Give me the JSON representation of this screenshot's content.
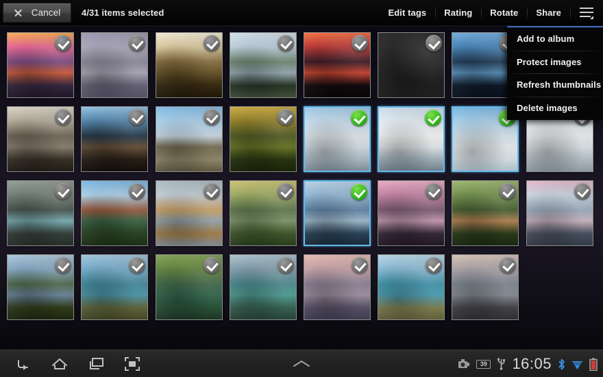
{
  "topbar": {
    "cancel_label": "Cancel",
    "selection_status": "4/31 items selected",
    "actions": [
      {
        "label": "Edit tags",
        "name": "edit-tags"
      },
      {
        "label": "Rating",
        "name": "rating"
      },
      {
        "label": "Rotate",
        "name": "rotate"
      },
      {
        "label": "Share",
        "name": "share"
      }
    ],
    "overflow_icon": "hamburger-menu-icon"
  },
  "menu": {
    "accent_color": "#3f6fbf",
    "items": [
      {
        "label": "Add to album"
      },
      {
        "label": "Protect images"
      },
      {
        "label": "Refresh thumbnails"
      },
      {
        "label": "Delete images"
      }
    ]
  },
  "selection": {
    "selected_count": 4,
    "total_count": 31,
    "selected_color": "#33b81e",
    "unselected_color": "#6f6f6f",
    "selected_border_color": "#63b8e8"
  },
  "grid": {
    "columns": 8,
    "rows": [
      {
        "thumbs": [
          {
            "selected": false,
            "desc": "sunset-lake-purple-mountains",
            "sky1": "#f9a84e",
            "sky2": "#e8608f",
            "sky3": "#7e4a86",
            "land": "#3a2a46",
            "water": "#d9603f",
            "fg": "#241a2b"
          },
          {
            "selected": false,
            "desc": "foggy-pine-forest",
            "sky1": "#9a96ad",
            "sky2": "#a8a4b8",
            "sky3": "#8f8ca0",
            "land": "#6d6a80",
            "water": "#b5b2c2",
            "fg": "#5e5b70"
          },
          {
            "selected": false,
            "desc": "horse-in-golden-field",
            "sky1": "#f0e7d2",
            "sky2": "#d9c79a",
            "sky3": "#8a6e3c",
            "land": "#3c2e14",
            "water": "#6b5526",
            "fg": "#241a08"
          },
          {
            "selected": false,
            "desc": "chapel-reflected-in-lake",
            "sky1": "#cfdde8",
            "sky2": "#b9cddb",
            "sky3": "#6f8a74",
            "land": "#2c3a2a",
            "water": "#9fb3bd",
            "fg": "#46563f"
          },
          {
            "selected": false,
            "desc": "bare-trees-red-sunset",
            "sky1": "#f26a3c",
            "sky2": "#b8302f",
            "sky3": "#3a1620",
            "land": "#120a10",
            "water": "#d1452f",
            "fg": "#0a0608"
          },
          {
            "selected": false,
            "desc": "dramatic-clouds-over-lake",
            "sky1": "#8fa8bc",
            "sky2": "#5b7287",
            "sky3": "#2c3c4c",
            "land": "#1a2430",
            "water": "#45soon",
            "fg": "#16202a"
          },
          {
            "selected": false,
            "desc": "lone-tree-blue-lake",
            "sky1": "#6aa8d8",
            "sky2": "#3f7fb5",
            "sky3": "#1c3a58",
            "land": "#0f1c2c",
            "water": "#5e9ccb",
            "fg": "#0a1420"
          },
          {
            "selected": false,
            "desc": "winter-tree-snow-field-hidden",
            "sky1": "#7fb3d8",
            "sky2": "#4c86b4",
            "sky3": "#26445e",
            "land": "#dfe8ef",
            "water": "#8fb8d4",
            "fg": "#1a2c3c"
          }
        ]
      },
      {
        "thumbs": [
          {
            "selected": false,
            "desc": "sunbeams-through-trees",
            "sky1": "#d8d2c4",
            "sky2": "#b0a896",
            "sky3": "#6f6454",
            "land": "#3c352a",
            "water": "#8e8472",
            "fg": "#241f18"
          },
          {
            "selected": false,
            "desc": "forest-backlit-trunks",
            "sky1": "#8fc0e0",
            "sky2": "#4b7fa8",
            "sky3": "#1f3444",
            "land": "#2b2118",
            "water": "#6a533a",
            "fg": "#140f0a"
          },
          {
            "selected": false,
            "desc": "pine-tree-blue-sky-field",
            "sky1": "#7fb8e4",
            "sky2": "#a7cfea",
            "sky3": "#cfe0ee",
            "land": "#9c9374",
            "water": "#7e7558",
            "fg": "#6a6248"
          },
          {
            "selected": false,
            "desc": "autumn-golden-forest",
            "sky1": "#c9a93c",
            "sky2": "#8e7a20",
            "sky3": "#4e5a1c",
            "land": "#2c3a12",
            "water": "#6d7c24",
            "fg": "#1c2608"
          },
          {
            "selected": true,
            "desc": "snowy-mountain-hut",
            "sky1": "#9cc6e4",
            "sky2": "#c6dced",
            "sky3": "#e8f0f6",
            "land": "#b9c9d4",
            "water": "#dfe9f0",
            "fg": "#8b9aa6"
          },
          {
            "selected": true,
            "desc": "snow-covered-fir-trees",
            "sky1": "#c8dbe8",
            "sky2": "#e4eef4",
            "sky3": "#ffffff",
            "land": "#aebfca",
            "water": "#f0f5f8",
            "fg": "#7e8e9a"
          },
          {
            "selected": true,
            "desc": "snowy-field-blue-sky",
            "sky1": "#74b4e0",
            "sky2": "#a8d0ea",
            "sky3": "#dfeef8",
            "land": "#e8f2f8",
            "water": "#f4f9fc",
            "fg": "#c0d4e0"
          },
          {
            "selected": false,
            "desc": "lone-snowy-fir-hidden",
            "sky1": "#cdd8e0",
            "sky2": "#e2e9ee",
            "sky3": "#f4f7f9",
            "land": "#c0ccd4",
            "water": "#e8eef2",
            "fg": "#9daab4"
          }
        ]
      },
      {
        "thumbs": [
          {
            "selected": false,
            "desc": "turquoise-river-rocks",
            "sky1": "#8e9a92",
            "sky2": "#6d7a70",
            "sky3": "#47544e",
            "land": "#3a4640",
            "water": "#7fb8bd",
            "fg": "#2a332e"
          },
          {
            "selected": false,
            "desc": "lakeside-village-red-roofs",
            "sky1": "#78b4e0",
            "sky2": "#a9cfe8",
            "sky3": "#9c5b3c",
            "land": "#2e4a26",
            "water": "#3f6b4a",
            "fg": "#1e3418"
          },
          {
            "selected": false,
            "desc": "wooden-piers-on-lake",
            "sky1": "#a9b8c0",
            "sky2": "#c0cbd2",
            "sky3": "#d4a86a",
            "land": "#b08850",
            "water": "#9fb0b8",
            "fg": "#8a9aa2"
          },
          {
            "selected": false,
            "desc": "autumn-trees-lake-shore",
            "sky1": "#c8c070",
            "sky2": "#9aa85e",
            "sky3": "#5e7a4a",
            "land": "#46602e",
            "water": "#86a070",
            "fg": "#2c4420"
          },
          {
            "selected": true,
            "desc": "bled-island-church-mountains",
            "sky1": "#b4cfe4",
            "sky2": "#8fb4d2",
            "sky3": "#5e86aa",
            "land": "#2e4a60",
            "water": "#a8c6da",
            "fg": "#1c2e3e"
          },
          {
            "selected": false,
            "desc": "pink-dawn-island-church",
            "sky1": "#e8a8c0",
            "sky2": "#c07e9e",
            "sky3": "#7e5a74",
            "land": "#3a2c3e",
            "water": "#d0a0ba",
            "fg": "#261c28"
          },
          {
            "selected": false,
            "desc": "wooden-boat-in-reeds",
            "sky1": "#9ab46a",
            "sky2": "#6e8c46",
            "sky3": "#44602c",
            "land": "#2c401c",
            "water": "#c08a56",
            "fg": "#1c2c12"
          },
          {
            "selected": false,
            "desc": "pink-clouds-reflection-lake",
            "sky1": "#e0b4c8",
            "sky2": "#c8d4e0",
            "sky3": "#a0b0c4",
            "land": "#4e5868",
            "water": "#d6c0cc",
            "fg": "#3a4250"
          }
        ]
      },
      {
        "thumbs": [
          {
            "selected": false,
            "desc": "trees-by-the-shore",
            "sky1": "#a8c4d8",
            "sky2": "#7ea4c0",
            "sky3": "#4e6a4a",
            "land": "#34421c",
            "water": "#6e8ca4",
            "fg": "#202a10"
          },
          {
            "selected": false,
            "desc": "coastal-bay-aerial",
            "sky1": "#9cc4dc",
            "sky2": "#6fa8c8",
            "sky3": "#3f8ca0",
            "land": "#6a6e40",
            "water": "#4fa0b4",
            "fg": "#4a4e2a"
          },
          {
            "selected": false,
            "desc": "green-pool-aerial",
            "sky1": "#7ea050",
            "sky2": "#5e8038",
            "sky3": "#3f6a48",
            "land": "#2e5a3e",
            "water": "#356e52",
            "fg": "#1e3c28"
          },
          {
            "selected": false,
            "desc": "cliff-rock-turquoise-sea",
            "sky1": "#a8c0cc",
            "sky2": "#7e9aa8",
            "sky3": "#4a8e92",
            "land": "#3e6a5a",
            "water": "#53a89c",
            "fg": "#2a4a3e"
          },
          {
            "selected": false,
            "desc": "misty-pink-lake-horizon",
            "sky1": "#e4b8b0",
            "sky2": "#c49ea4",
            "sky3": "#8e8298",
            "land": "#5e5870",
            "water": "#a898ac",
            "fg": "#46425a"
          },
          {
            "selected": false,
            "desc": "tropical-beach-tree",
            "sky1": "#b4d4e4",
            "sky2": "#84b8d4",
            "sky3": "#3f9ab4",
            "land": "#8a8a58",
            "water": "#4fa8c0",
            "fg": "#6a6a40"
          },
          {
            "selected": false,
            "desc": "rocky-islet-at-dusk",
            "sky1": "#d4c0b4",
            "sky2": "#a8a0a4",
            "sky3": "#7e8894",
            "land": "#4a4a4e",
            "water": "#8e949c",
            "fg": "#34343a"
          }
        ]
      }
    ]
  },
  "sysbar": {
    "nav": [
      {
        "name": "back-button",
        "icon": "back-arrow-icon"
      },
      {
        "name": "home-button",
        "icon": "home-icon"
      },
      {
        "name": "recent-apps-button",
        "icon": "recent-apps-icon"
      },
      {
        "name": "screenshot-button",
        "icon": "screenshot-icon"
      }
    ],
    "expand_icon": "chevron-up-icon",
    "clock": "16:05",
    "status_icons": [
      {
        "name": "camera-icon"
      },
      {
        "name": "notification-count-badge",
        "value": "39"
      },
      {
        "name": "usb-icon"
      },
      {
        "name": "bluetooth-icon",
        "color": "#3a8fe0"
      },
      {
        "name": "wifi-icon",
        "color": "#3a8fe0"
      },
      {
        "name": "battery-low-icon",
        "color": "#c94040"
      }
    ]
  }
}
